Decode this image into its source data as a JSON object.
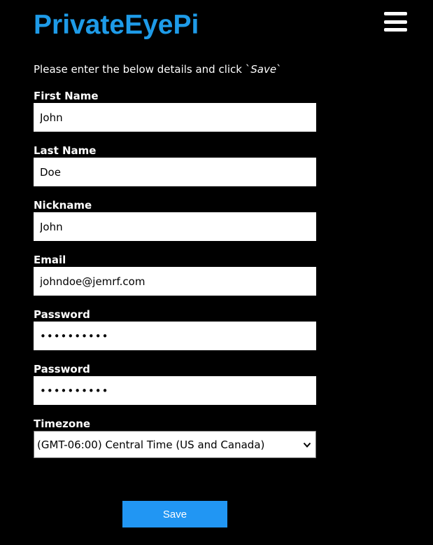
{
  "header": {
    "brand": "PrivateEyePi",
    "menu_icon": "hamburger-menu-icon"
  },
  "form": {
    "intro_prefix": "Please enter the below details and click `",
    "intro_save": "Save",
    "intro_suffix": "`",
    "first_name": {
      "label": "First Name",
      "value": "John"
    },
    "last_name": {
      "label": "Last Name",
      "value": "Doe"
    },
    "nickname": {
      "label": "Nickname",
      "value": "John"
    },
    "email": {
      "label": "Email",
      "value": "johndoe@jemrf.com"
    },
    "password": {
      "label": "Password",
      "value": "••••••••••"
    },
    "password_confirm": {
      "label": "Password",
      "value": "••••••••••"
    },
    "timezone": {
      "label": "Timezone",
      "selected": "(GMT-06:00) Central Time (US and Canada)"
    },
    "save_label": "Save"
  },
  "colors": {
    "background": "#000000",
    "brand": "#1e9be8",
    "button": "#2196f3"
  }
}
